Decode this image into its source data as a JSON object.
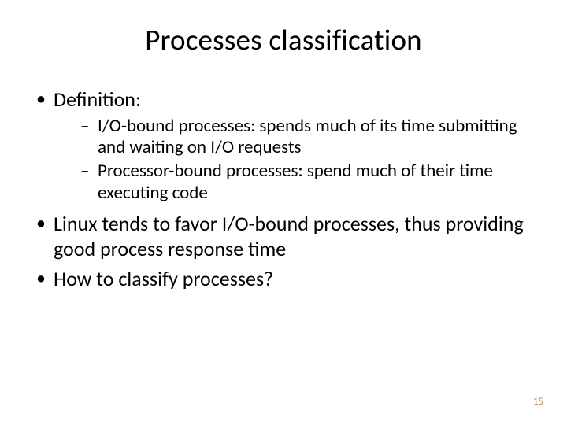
{
  "title": "Processes classification",
  "bullets": {
    "definition_label": "Definition:",
    "sub": {
      "io_bound": "I/O-bound processes: spends much of its time submitting and waiting on I/O requests",
      "cpu_bound": "Processor-bound processes: spend much of their time executing code"
    },
    "linux": "Linux tends to favor I/O-bound processes, thus providing good process response time",
    "classify": "How to classify processes?"
  },
  "page_number": "15"
}
